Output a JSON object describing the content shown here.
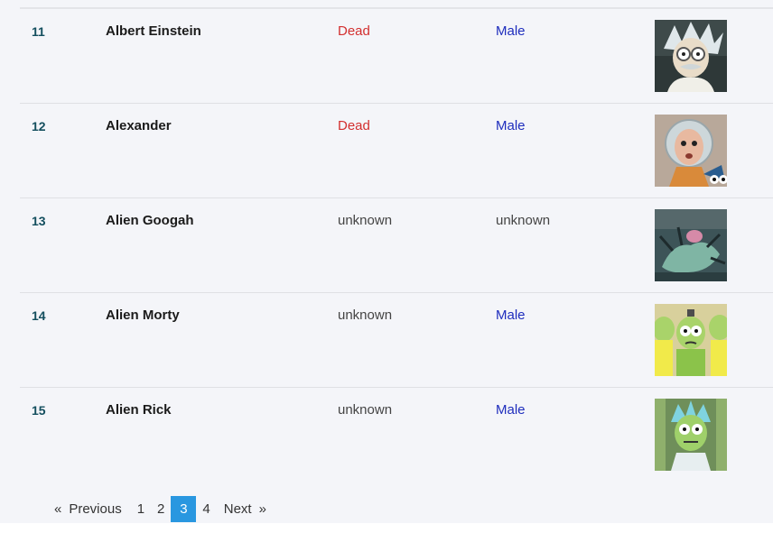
{
  "rows": [
    {
      "id": "11",
      "name": "Albert Einstein",
      "status": "Dead",
      "gender": "Male",
      "status_color": "#d32f2f",
      "gender_color": "#1e2dbd",
      "avatar": "albert-einstein"
    },
    {
      "id": "12",
      "name": "Alexander",
      "status": "Dead",
      "gender": "Male",
      "status_color": "#d32f2f",
      "gender_color": "#1e2dbd",
      "avatar": "alexander"
    },
    {
      "id": "13",
      "name": "Alien Googah",
      "status": "unknown",
      "gender": "unknown",
      "status_color": "#444444",
      "gender_color": "#444444",
      "avatar": "alien-googah"
    },
    {
      "id": "14",
      "name": "Alien Morty",
      "status": "unknown",
      "gender": "Male",
      "status_color": "#444444",
      "gender_color": "#1e2dbd",
      "avatar": "alien-morty"
    },
    {
      "id": "15",
      "name": "Alien Rick",
      "status": "unknown",
      "gender": "Male",
      "status_color": "#444444",
      "gender_color": "#1e2dbd",
      "avatar": "alien-rick"
    }
  ],
  "pagination": {
    "first_symbol": "«",
    "previous": "Previous",
    "pages": [
      "1",
      "2",
      "3",
      "4"
    ],
    "current": "3",
    "next": "Next",
    "last_symbol": "»",
    "active_color": "#2997e0"
  }
}
